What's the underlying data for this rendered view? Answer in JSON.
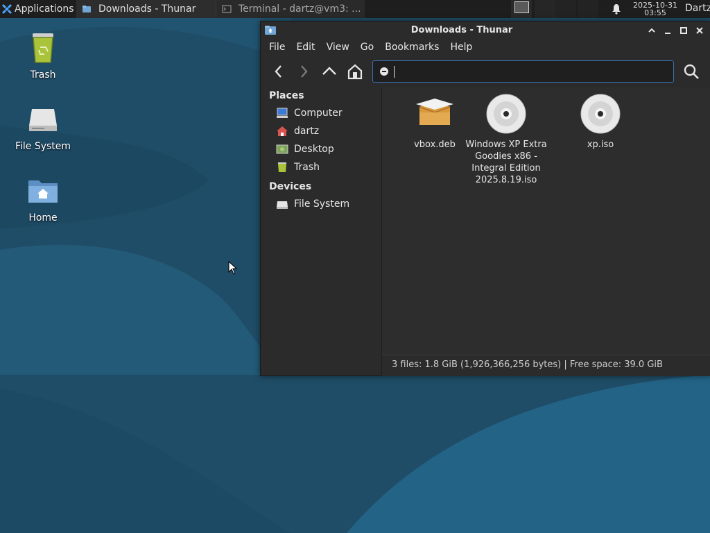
{
  "panel": {
    "applications_label": "Applications",
    "applications_extra": "☰",
    "tasks": [
      {
        "label": "Downloads - Thunar",
        "active": true
      },
      {
        "label": "Terminal - dartz@vm3: ...",
        "active": false
      }
    ],
    "clock_date": "2025-10-31",
    "clock_time": "03:55",
    "user": "Dartz"
  },
  "desktop": {
    "icons": [
      {
        "label": "Trash",
        "icon": "trash-icon"
      },
      {
        "label": "File System",
        "icon": "drive-icon"
      },
      {
        "label": "Home",
        "icon": "home-folder-icon"
      }
    ]
  },
  "window": {
    "title": "Downloads - Thunar",
    "menu": [
      "File",
      "Edit",
      "View",
      "Go",
      "Bookmarks",
      "Help"
    ],
    "location_value": "",
    "sidebar": {
      "places_header": "Places",
      "places": [
        "Computer",
        "dartz",
        "Desktop",
        "Trash"
      ],
      "devices_header": "Devices",
      "devices": [
        "File System"
      ]
    },
    "files": [
      {
        "name": "vbox.deb",
        "icon": "package-icon"
      },
      {
        "name": "Windows XP Extra Goodies x86 - Integral Edition 2025.8.19.iso",
        "icon": "disc-icon"
      },
      {
        "name": "xp.iso",
        "icon": "disc-icon"
      }
    ],
    "status": "3 files: 1.8 GiB (1,926,366,256 bytes)  |  Free space: 39.0 GiB"
  },
  "colors": {
    "panel_bg": "#1e1e1e",
    "window_bg": "#2b2b2b",
    "accent": "#3b6fb0",
    "wallpaper": "#1f4d66"
  }
}
